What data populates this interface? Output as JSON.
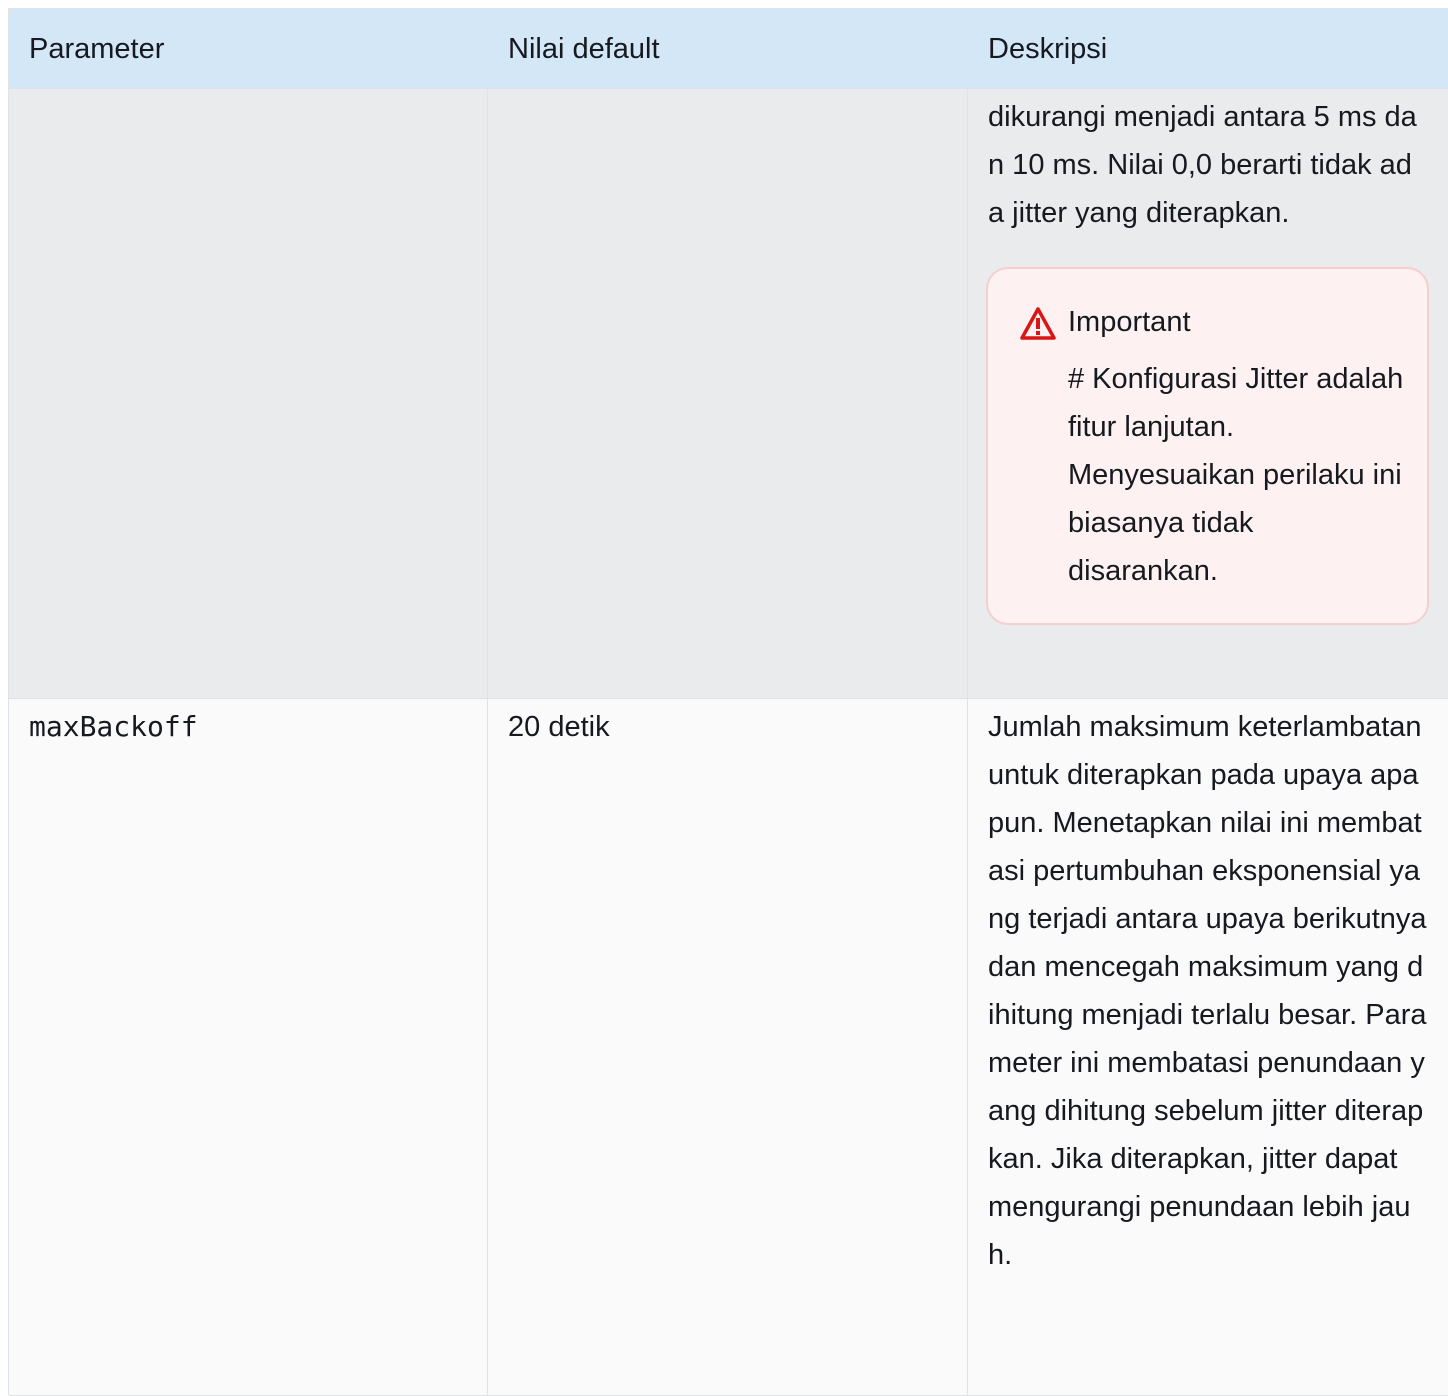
{
  "table": {
    "headers": [
      "Parameter",
      "Nilai default",
      "Deskripsi"
    ],
    "rows": [
      {
        "parameter": "",
        "default": "",
        "description": "dikurangi menjadi antara 5 ms dan 10 ms. Nilai 0,0 berarti tidak ada jitter yang diterapkan.",
        "callout": {
          "icon": "warning-icon",
          "title": "Important",
          "text": "# Konfigurasi Jitter adalah fitur lanjutan. Menyesuaikan perilaku ini biasanya tidak disarankan.",
          "accent": "#d91515"
        }
      },
      {
        "parameter": "maxBackoff",
        "default": "20 detik",
        "description": "Jumlah maksimum keterlambatan untuk diterapkan pada upaya apa pun. Menetapkan nilai ini membatasi pertumbuhan eksponensial yang terjadi antara upaya berikutnya dan mencegah maksimum yang dihitung menjadi terlalu besar. Parameter ini membatasi penundaan yang dihitung sebelum jitter diterapkan. Jika diterapkan, jitter dapat mengurangi penundaan lebih jauh."
      }
    ]
  },
  "colors": {
    "header_bg": "#d4e7f7",
    "row_shaded_bg": "#e9ebed",
    "row_bg": "#fafafa",
    "callout_bg": "#fdf2f1",
    "callout_border": "#f5cfcb"
  }
}
